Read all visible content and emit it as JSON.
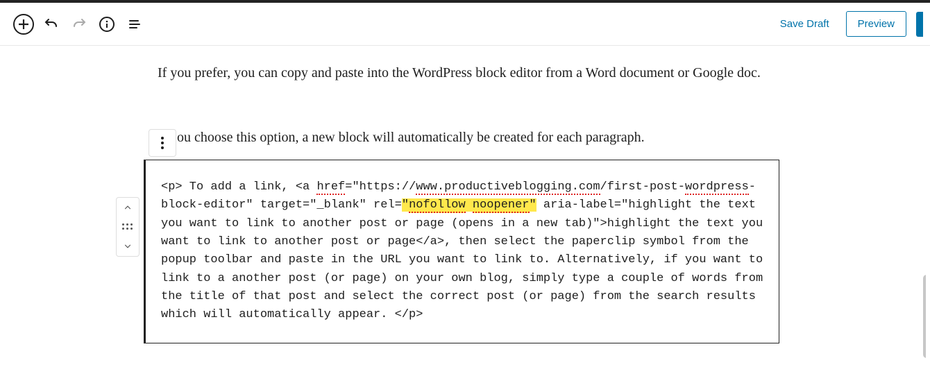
{
  "toolbar": {
    "save_draft_label": "Save Draft",
    "preview_label": "Preview"
  },
  "paragraph1": "If you prefer,  you can copy and paste into the WordPress block editor from a Word document or Google doc.",
  "paragraph2_visible": "ou choose this option, a new block will automatically be created for each paragraph.",
  "code": {
    "seg1": "<p> To add a link, <a ",
    "href_word": "href",
    "seg2": "=\"https://",
    "url_part1": "www.productiveblogging.com",
    "seg3": "/first-post-",
    "url_part2": "wordpress",
    "seg4": "-block-editor\" target=\"_blank\" rel=",
    "hlq": "\"",
    "hl1": "nofollow",
    "hlspace": " ",
    "hl2": "noopener",
    "seg5": " aria-label=\"highlight the text you want to link to another post or page (opens in a new tab)\">highlight the text you want to link to another post or page</a>, then select the paperclip symbol from the popup toolbar and paste in the URL you want to link to. Alternatively, if you want to link to a another post (or page) on your own blog, simply type a couple of words from the title of that post and select the correct post (or page) from the search results which will automatically appear. </p>"
  },
  "icons": {
    "add": "add-block-icon",
    "undo": "undo-icon",
    "redo": "redo-icon",
    "info": "info-icon",
    "outline": "list-view-icon",
    "more": "more-icon",
    "up": "chevron-up-icon",
    "drag": "drag-icon",
    "down": "chevron-down-icon"
  }
}
